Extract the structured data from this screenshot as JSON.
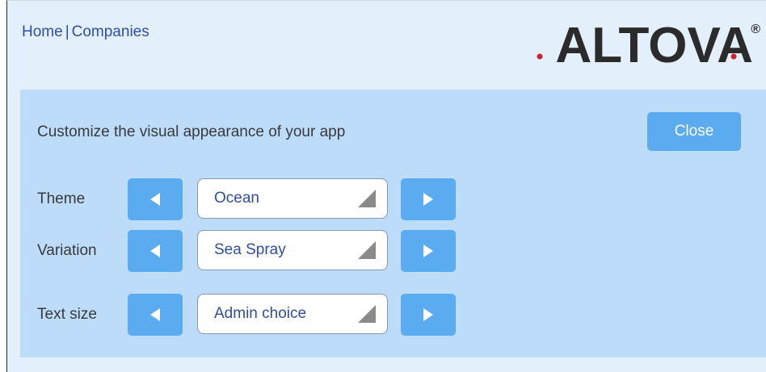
{
  "breadcrumb": {
    "home": "Home",
    "separator": "|",
    "current": "Companies"
  },
  "logo": {
    "text": "ALTOVA",
    "mark": "®",
    "icon": "altova-logo"
  },
  "panel": {
    "intro": "Customize the visual appearance of your app",
    "close_label": "Close",
    "rows": [
      {
        "label": "Theme",
        "value": "Ocean",
        "prev_icon": "triangle-left-icon",
        "next_icon": "triangle-right-icon"
      },
      {
        "label": "Variation",
        "value": "Sea Spray",
        "prev_icon": "triangle-left-icon",
        "next_icon": "triangle-right-icon"
      },
      {
        "label": "Text size",
        "value": "Admin choice",
        "prev_icon": "triangle-left-icon",
        "next_icon": "triangle-right-icon"
      }
    ]
  },
  "colors": {
    "page_bg": "#e3f0fb",
    "panel_bg": "#bcdcfa",
    "button": "#5aabf0",
    "link": "#2d4fa8",
    "logo_red": "#d0202f",
    "logo_dark": "#2b2b2b"
  }
}
